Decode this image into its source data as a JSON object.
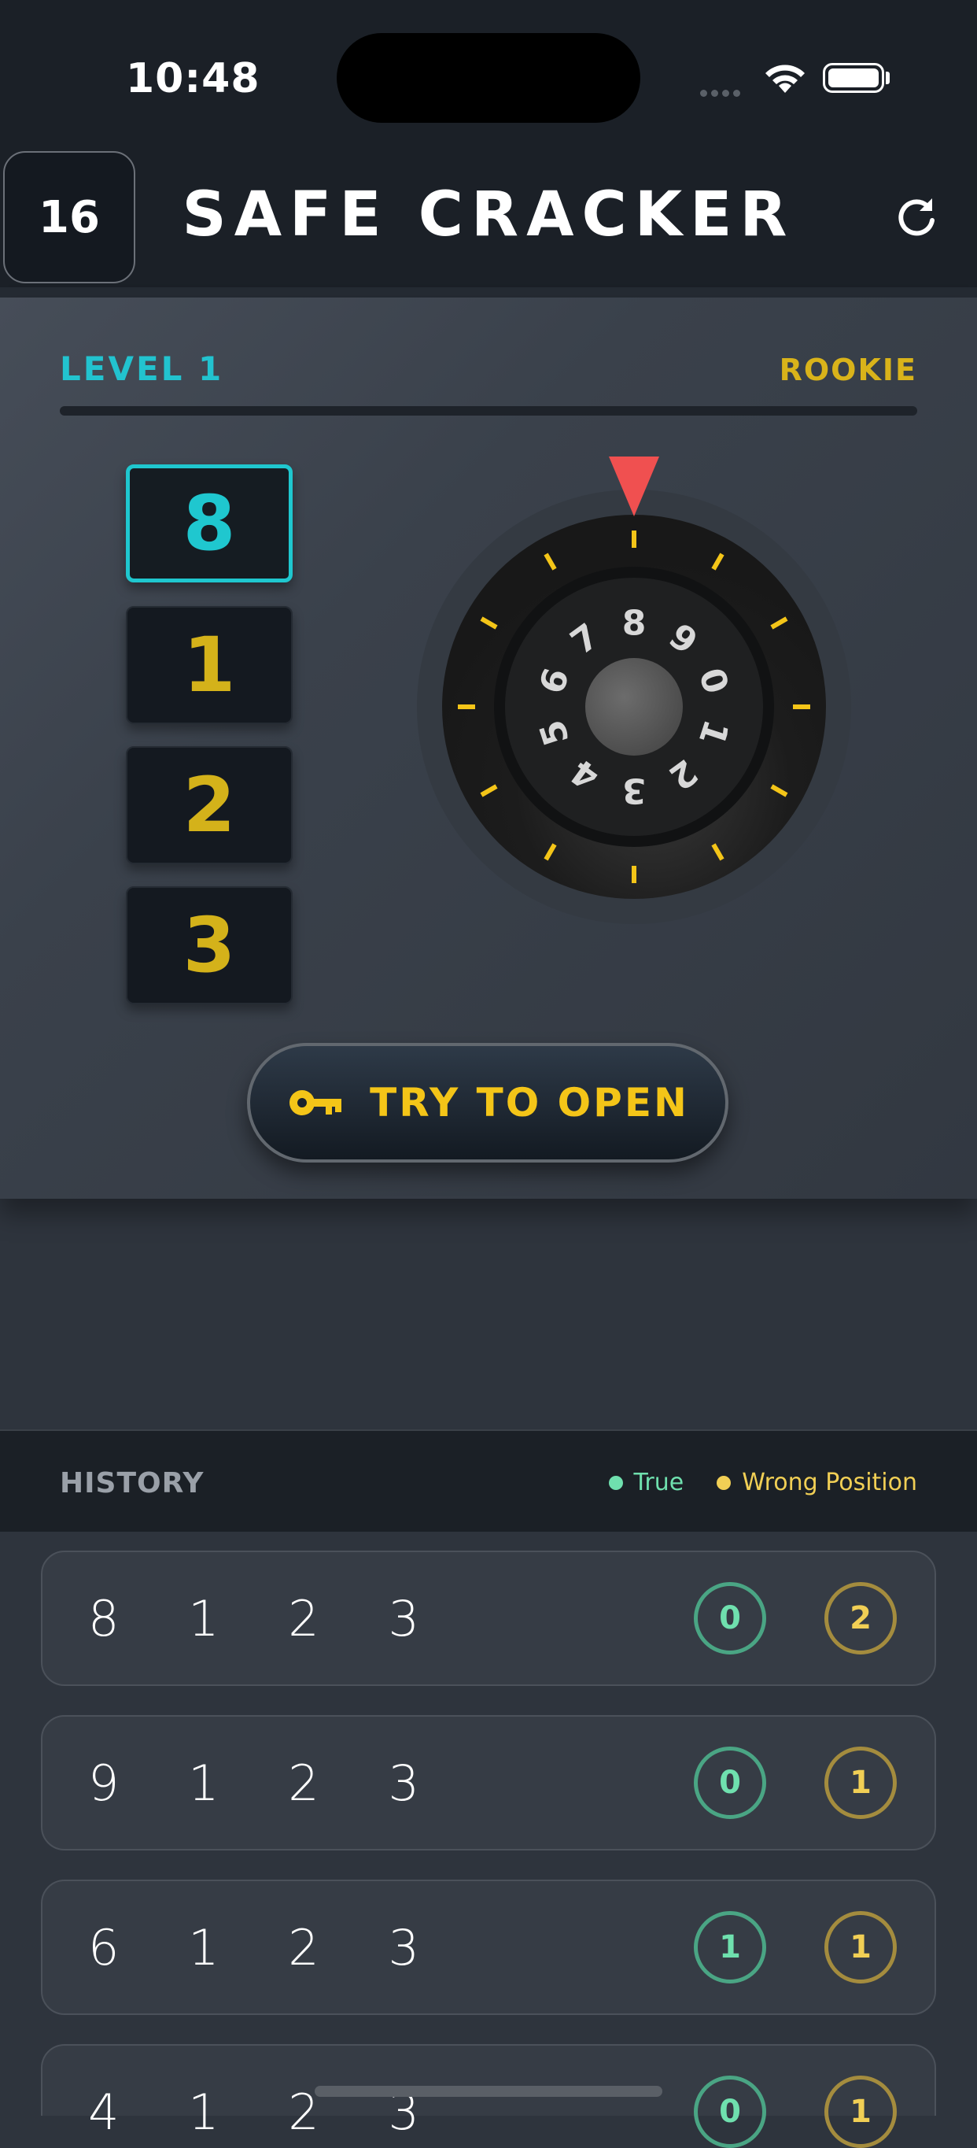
{
  "status_bar": {
    "time": "10:48"
  },
  "header": {
    "attempts": "16",
    "title": "SAFE CRACKER",
    "refresh_icon": "refresh-icon"
  },
  "game": {
    "level_label": "LEVEL 1",
    "rank_label": "ROOKIE",
    "digits": [
      "8",
      "1",
      "2",
      "3"
    ],
    "active_digit_index": 0,
    "dial_numbers": [
      "8",
      "9",
      "0",
      "1",
      "2",
      "3",
      "4",
      "5",
      "6",
      "7"
    ],
    "open_button_label": "TRY TO OPEN",
    "colors": {
      "cyan": "#1fc7cf",
      "gold": "#f4c518",
      "pointer": "#f05050"
    }
  },
  "history": {
    "title": "HISTORY",
    "legend": {
      "true_label": "True",
      "wrong_label": "Wrong Position"
    },
    "rows": [
      {
        "digits": "8 1 2 3",
        "true": "0",
        "wrong": "2"
      },
      {
        "digits": "9 1 2 3",
        "true": "0",
        "wrong": "1"
      },
      {
        "digits": "6 1 2 3",
        "true": "1",
        "wrong": "1"
      },
      {
        "digits": "4 1 2 3",
        "true": "0",
        "wrong": "1"
      }
    ]
  }
}
